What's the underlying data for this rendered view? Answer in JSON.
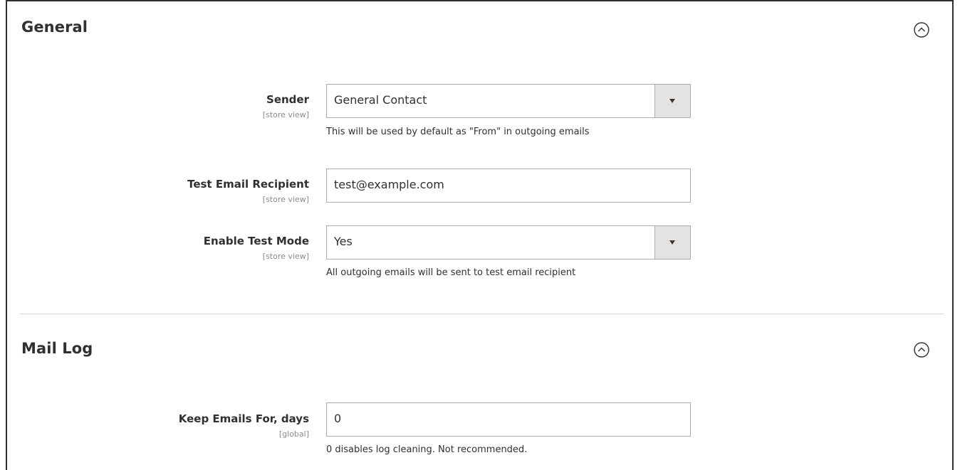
{
  "sections": {
    "general": {
      "title": "General",
      "fields": {
        "sender": {
          "label": "Sender",
          "scope": "[store view]",
          "value": "General Contact",
          "note": "This will be used by default as \"From\" in outgoing emails"
        },
        "test_recipient": {
          "label": "Test Email Recipient",
          "scope": "[store view]",
          "value": "test@example.com"
        },
        "test_mode": {
          "label": "Enable Test Mode",
          "scope": "[store view]",
          "value": "Yes",
          "note": "All outgoing emails will be sent to test email recipient"
        }
      }
    },
    "mail_log": {
      "title": "Mail Log",
      "fields": {
        "keep_days": {
          "label": "Keep Emails For, days",
          "scope": "[global]",
          "value": "0",
          "note": "0 disables log cleaning. Not recommended."
        }
      }
    }
  },
  "icons": {
    "collapse": "chevron-up-circle-icon",
    "dropdown": "triangle-down-icon"
  },
  "colors": {
    "text": "#303030",
    "scope_text": "#8c8c8c",
    "border": "#adadad",
    "select_button": "#e3e3e3",
    "divider": "#d6d6d6"
  }
}
